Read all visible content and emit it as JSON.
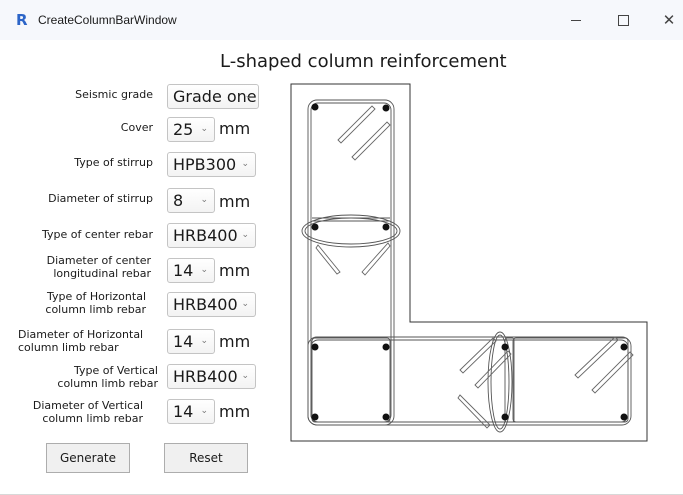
{
  "window": {
    "title": "CreateColumnBarWindow",
    "icon_letter": "R",
    "controls": {
      "minimize": "minimize-icon",
      "maximize": "maximize-icon",
      "close": "close-icon"
    }
  },
  "heading": "L-shaped column reinforcement",
  "form": {
    "seismic_grade": {
      "label": "Seismic grade",
      "value": "Grade one"
    },
    "cover": {
      "label": "Cover",
      "value": "25",
      "unit": "mm"
    },
    "stirrup_type": {
      "label": "Type of stirrup",
      "value": "HPB300"
    },
    "stirrup_diameter": {
      "label": "Diameter of stirrup",
      "value": "8",
      "unit": "mm"
    },
    "center_rebar_type": {
      "label": "Type of center rebar",
      "value": "HRB400"
    },
    "center_rebar_diameter": {
      "label_line1": "Diameter of center",
      "label_line2": "longitudinal rebar",
      "value": "14",
      "unit": "mm"
    },
    "horizontal_type": {
      "label_line1": "Type of Horizontal",
      "label_line2": "column limb rebar",
      "value": "HRB400"
    },
    "horizontal_diameter": {
      "label_line1": "Diameter of Horizontal",
      "label_line2": "column limb rebar",
      "value": "14",
      "unit": "mm"
    },
    "vertical_type": {
      "label_line1": "Type of Vertical",
      "label_line2": "column limb rebar",
      "value": "HRB400"
    },
    "vertical_diameter": {
      "label_line1": "Diameter of Vertical",
      "label_line2": "column limb rebar",
      "value": "14",
      "unit": "mm"
    }
  },
  "buttons": {
    "generate": "Generate",
    "reset": "Reset"
  },
  "icons": {
    "dropdown": "chevron-down-icon"
  }
}
